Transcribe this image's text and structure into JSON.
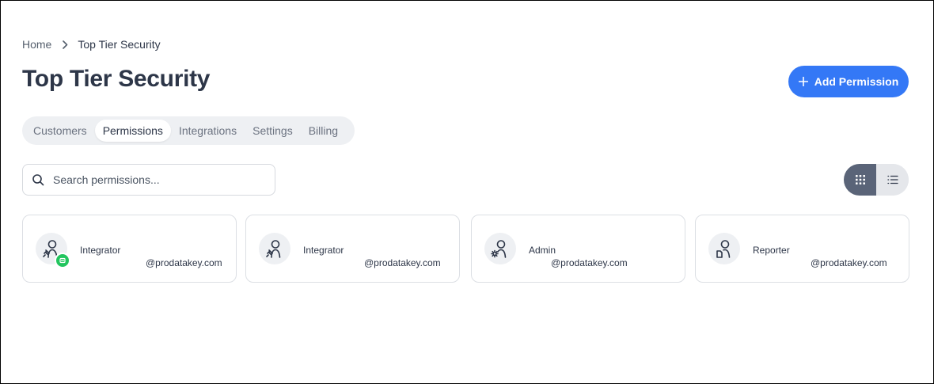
{
  "breadcrumb": {
    "home": "Home",
    "current": "Top Tier Security"
  },
  "page": {
    "title": "Top Tier Security"
  },
  "actions": {
    "add_permission": "Add Permission"
  },
  "tabs": [
    {
      "label": "Customers",
      "active": false
    },
    {
      "label": "Permissions",
      "active": true
    },
    {
      "label": "Integrations",
      "active": false
    },
    {
      "label": "Settings",
      "active": false
    },
    {
      "label": "Billing",
      "active": false
    }
  ],
  "search": {
    "placeholder": "Search permissions...",
    "value": ""
  },
  "view_toggle": {
    "selected": "grid",
    "options": [
      "grid",
      "list"
    ]
  },
  "colors": {
    "accent": "#3478f6",
    "badge": "#22c55e",
    "toggle_active": "#5a6478"
  },
  "cards": [
    {
      "role": "Integrator",
      "domain": "@prodatakey.com",
      "icon": "integrator-icon",
      "badge": "green-status-badge"
    },
    {
      "role": "Integrator",
      "domain": "@prodatakey.com",
      "icon": "integrator-icon"
    },
    {
      "role": "Admin",
      "domain": "@prodatakey.com",
      "icon": "admin-gear-icon"
    },
    {
      "role": "Reporter",
      "domain": "@prodatakey.com",
      "icon": "reporter-icon"
    }
  ]
}
